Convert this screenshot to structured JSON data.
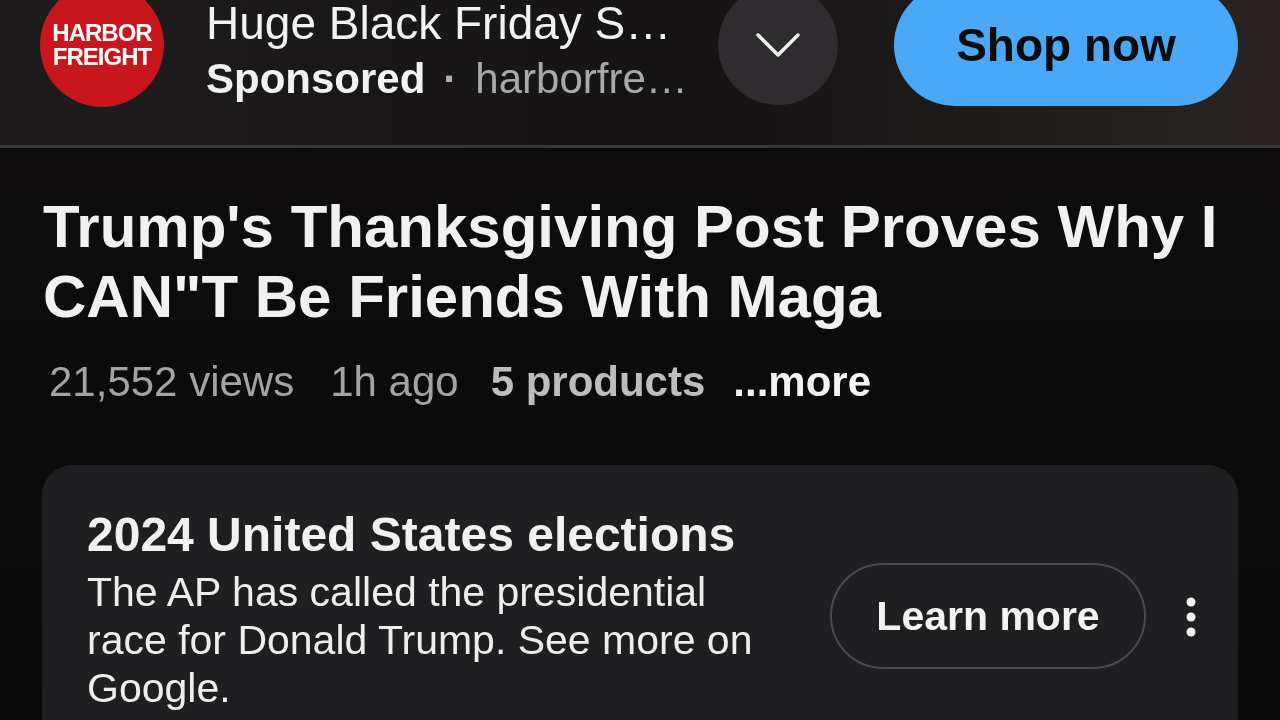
{
  "ad": {
    "logo_text": "HARBOR FREIGHT",
    "title": "Huge Black Friday S…",
    "sponsored_label": "Sponsored",
    "separator": "·",
    "domain": "harborfre…",
    "action_button": "Shop now"
  },
  "video": {
    "title": "Trump's Thanksgiving Post Proves Why I CAN\"T Be Friends With Maga",
    "views": "21,552 views",
    "age": "1h ago",
    "products": "5 products",
    "more_link": "...more"
  },
  "info_panel": {
    "title": "2024 United States elections",
    "body": "The AP has called the presidential race for Donald Trump. See more on Google.",
    "button": "Learn more"
  }
}
